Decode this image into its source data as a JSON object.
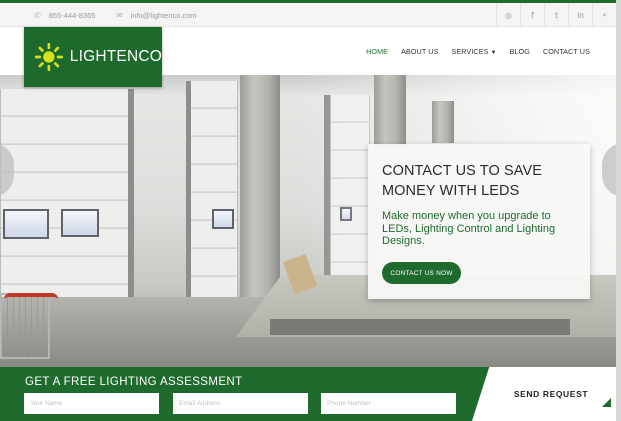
{
  "topbar": {
    "phone": "855-444-8365",
    "email": "info@lightenco.com",
    "phone_icon": "phone-icon",
    "email_icon": "envelope-icon",
    "socials": [
      {
        "name": "instagram-icon",
        "glyph": "◎"
      },
      {
        "name": "facebook-icon",
        "glyph": "f"
      },
      {
        "name": "twitter-icon",
        "glyph": "t"
      },
      {
        "name": "linkedin-icon",
        "glyph": "in"
      },
      {
        "name": "search-icon",
        "glyph": "⌕"
      }
    ]
  },
  "logo": {
    "text": "LIGHTENCO"
  },
  "nav": {
    "items": [
      {
        "label": "HOME",
        "active": true
      },
      {
        "label": "ABOUT US"
      },
      {
        "label": "SERVICES",
        "caret": "▼"
      },
      {
        "label": "BLOG"
      },
      {
        "label": "CONTACT US"
      }
    ]
  },
  "hero": {
    "cta_title": "CONTACT US TO SAVE MONEY WITH LEDS",
    "cta_text": "Make money when you upgrade to LEDs, Lighting Control and Lighting Designs.",
    "cta_button": "CONTACT US NOW"
  },
  "lead_form": {
    "title": "GET A FREE LIGHTING ASSESSMENT",
    "name_placeholder": "Your Name",
    "email_placeholder": "Email Address",
    "phone_placeholder": "Phone Number",
    "submit_label": "SEND REQUEST"
  },
  "colors": {
    "brand_green": "#1e6b2d",
    "logo_sun": "#d6e21a"
  }
}
